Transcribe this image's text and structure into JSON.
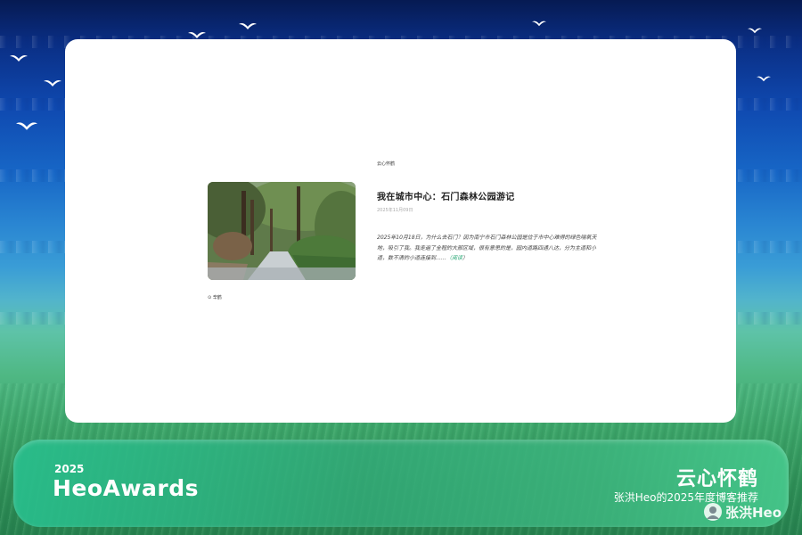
{
  "blog_card": {
    "site_name": "云心怀鹤",
    "post": {
      "title": "我在城市中心：石门森林公园游记",
      "date": "2025年11月09日",
      "excerpt": "2025年10月18日，为什么去石门？因为南宁市石门森林公园是位于市中心难得的绿色喘氧天地，吸引了我。我走遍了全程的大部区域，很有意思的是，园内道路四通八达，分为主道和小道，数不清的小道连接到……",
      "read_more_open": "（",
      "read_more_label": "阅读",
      "read_more_close": "）",
      "link_color": "#2aa876"
    },
    "author": "⊙ 辛鹤"
  },
  "award_banner": {
    "year": "2025",
    "name": "HeoAwards",
    "blog_name": "云心怀鹤",
    "recommendation": "张洪Heo的2025年度博客推荐"
  },
  "watermark": {
    "text": "张洪Heo"
  },
  "colors": {
    "sky_top": "#061a52",
    "grass": "#3da56a",
    "banner": "#32b482",
    "card": "#ffffff"
  }
}
